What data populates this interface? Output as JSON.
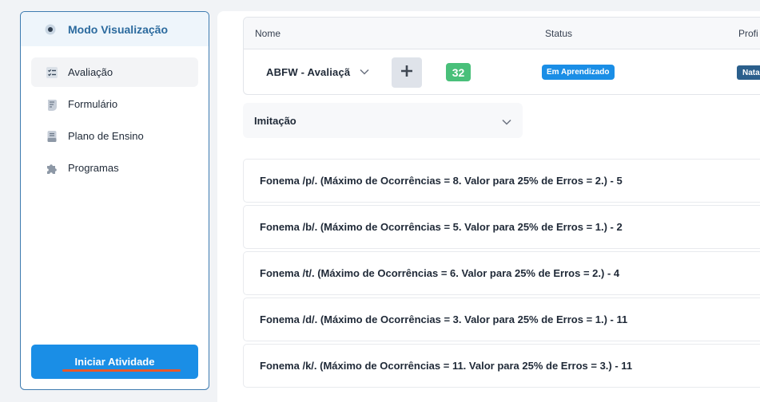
{
  "sidebar": {
    "header": "Modo Visualização",
    "items": [
      {
        "label": "Avaliação",
        "icon": "checklist-icon"
      },
      {
        "label": "Formulário",
        "icon": "form-icon"
      },
      {
        "label": "Plano de Ensino",
        "icon": "document-icon"
      },
      {
        "label": "Programas",
        "icon": "puzzle-icon"
      }
    ],
    "start_button": "Iniciar Atividade"
  },
  "table": {
    "columns": [
      "Nome",
      "Status",
      "Profi"
    ],
    "row": {
      "name": "ABFW - Avaliaçã",
      "count": "32",
      "status": "Em Aprendizado",
      "proficiency": "Nata"
    }
  },
  "section": {
    "title": "Imitação"
  },
  "items": [
    "Fonema /p/. (Máximo de Ocorrências = 8. Valor para 25% de Erros = 2.) - 5",
    "Fonema /b/. (Máximo de Ocorrências = 5. Valor para 25% de Erros = 1.) - 2",
    "Fonema /t/. (Máximo de Ocorrências = 6. Valor para 25% de Erros = 2.) - 4",
    "Fonema /d/. (Máximo de Ocorrências = 3. Valor para 25% de Erros = 1.) - 11",
    "Fonema /k/. (Máximo de Ocorrências = 11. Valor para 25% de Erros = 3.) - 11"
  ],
  "colors": {
    "primary": "#1a8ee6",
    "count_badge": "#49c07a",
    "proficiency_badge": "#2b5f8c",
    "sidebar_border": "#3d7bb0",
    "accent_underline": "#e8572a"
  }
}
